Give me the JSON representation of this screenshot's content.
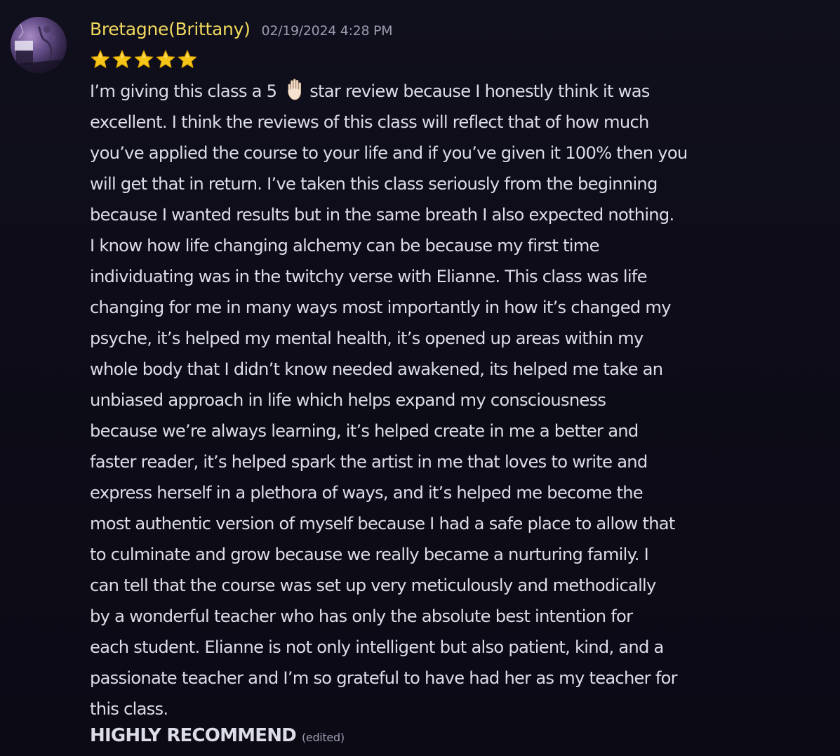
{
  "message": {
    "author": "Bretagne(Brittany)",
    "timestamp": "02/19/2024 4:28 PM",
    "rating": 5,
    "stars": [
      "star-icon",
      "star-icon",
      "star-icon",
      "star-icon",
      "star-icon"
    ],
    "body_lines": [
      {
        "before": "I’m giving this class a 5 ",
        "emoji": "raised-hand-icon",
        "after": "star review because I honestly think it was"
      },
      {
        "text": "excellent. I think the reviews of this class will reflect that of how much"
      },
      {
        "text": "you’ve applied the course to your life and if you’ve given it 100% then you"
      },
      {
        "text": "will get that in return. I’ve taken this class seriously from the beginning"
      },
      {
        "text": "because I wanted results but in the same breath I also expected nothing."
      },
      {
        "text": "I know how life changing alchemy can be because my first time"
      },
      {
        "text": "individuating was in the twitchy verse with Elianne. This class was life"
      },
      {
        "text": "changing for me in many ways most importantly in how it’s changed my"
      },
      {
        "text": "psyche, it’s helped my mental health, it’s opened up areas within my"
      },
      {
        "text": "whole body that I didn’t know needed awakened, its helped me take an"
      },
      {
        "text": "unbiased approach in life which helps expand my consciousness"
      },
      {
        "text": "because we’re always learning, it’s helped create in me a better and"
      },
      {
        "text": "faster reader, it’s helped spark the artist in me that loves to write and"
      },
      {
        "text": "express herself in a plethora of ways, and it’s helped me become the"
      },
      {
        "text": "most authentic version of myself because I had a safe place to allow that"
      },
      {
        "text": "to culminate and grow because we really became a nurturing family. I"
      },
      {
        "text": "can tell that the course was set up very meticulously and methodically"
      },
      {
        "text": "by a wonderful teacher who has only the absolute best intention for"
      },
      {
        "text": "each student. Elianne is not only intelligent but also patient, kind, and a"
      },
      {
        "text": "passionate teacher and I’m so grateful to have had her as my teacher for"
      },
      {
        "text": "this class."
      }
    ],
    "closing": "HIGHLY RECOMMEND",
    "edited_label": "(edited)"
  },
  "colors": {
    "background": "#0d0c18",
    "username": "#f0d95c",
    "text": "#dcdde8",
    "muted": "#9a9bb0",
    "star": "#f5c518"
  }
}
